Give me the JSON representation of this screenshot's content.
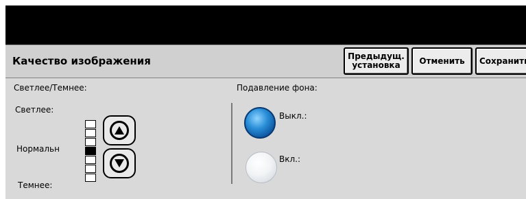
{
  "header": {
    "title": "Качество изображения",
    "prev_setting_line1": "Предыдущ.",
    "prev_setting_line2": "установка",
    "cancel_label": "Отменить",
    "save_label": "Сохранить"
  },
  "darkness": {
    "section_label": "Светлее/Темнее:",
    "lighter_label": "Светлее:",
    "normal_label": "Нормальн",
    "darker_label": "Темнее:",
    "levels_total": 7,
    "level_selected_index": 3,
    "up_icon": "triangle-up-icon",
    "down_icon": "triangle-down-icon"
  },
  "background": {
    "section_label": "Подавление фона:",
    "option_off_label": "Выкл.:",
    "option_on_label": "Вкл.:",
    "selected": "off",
    "selected_color": "#1e7fd0"
  }
}
